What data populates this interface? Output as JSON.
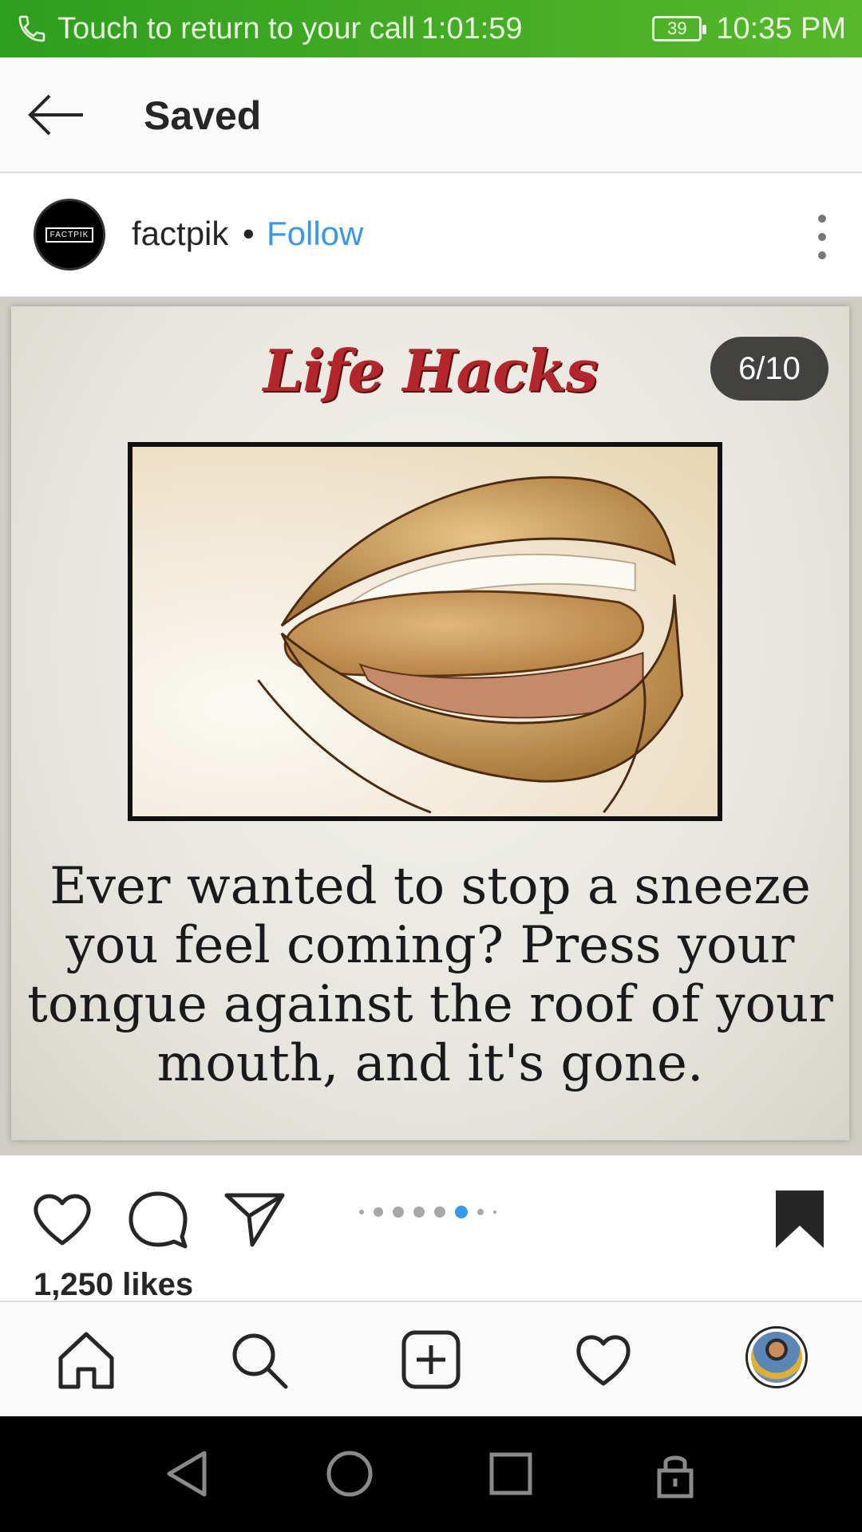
{
  "status_bar": {
    "call_text": "Touch to return to your call",
    "call_timer": "1:01:59",
    "battery": "39",
    "time": "10:35 PM"
  },
  "header": {
    "title": "Saved"
  },
  "post": {
    "username": "factpik",
    "separator": "•",
    "follow_label": "Follow",
    "avatar_logo_text": "FACTPIK",
    "image": {
      "heading": "Life Hacks",
      "counter": "6/10",
      "caption_lines": [
        "Ever wanted to stop a sneeze",
        "you feel coming? Press your",
        "tongue against the roof of your",
        "mouth, and  it's gone."
      ]
    },
    "carousel": {
      "current": 6,
      "total": 10
    },
    "likes": "1,250 likes"
  },
  "colors": {
    "status_bar": "#3aa822",
    "follow": "#3897f0",
    "heading": "#b3262b",
    "active_dot": "#3897f0"
  },
  "icons": {
    "header": [
      "back-arrow-icon"
    ],
    "actions": [
      "heart-icon",
      "comment-icon",
      "share-icon",
      "bookmark-icon"
    ],
    "bottom_nav": [
      "home-icon",
      "search-icon",
      "new-post-icon",
      "activity-heart-icon",
      "profile-avatar"
    ],
    "system_nav": [
      "back-triangle-icon",
      "home-circle-icon",
      "recents-square-icon",
      "lock-icon"
    ]
  }
}
